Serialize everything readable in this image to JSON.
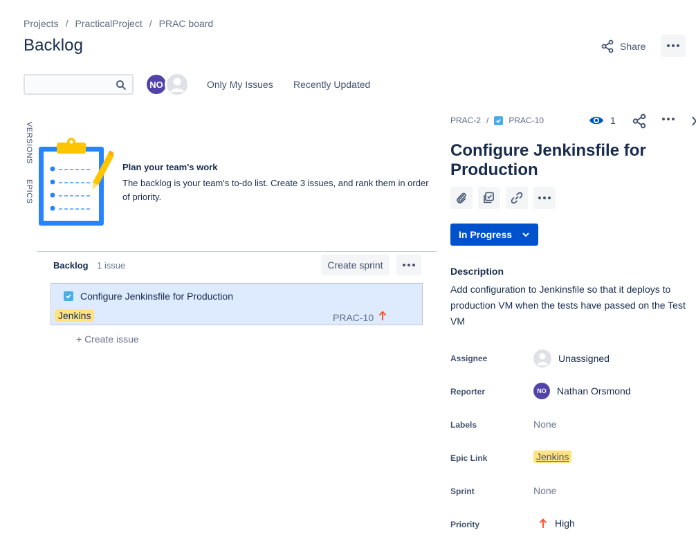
{
  "breadcrumb": {
    "items": [
      "Projects",
      "PracticalProject",
      "PRAC board"
    ],
    "separator": "/"
  },
  "page": {
    "title": "Backlog"
  },
  "header_actions": {
    "share_label": "Share"
  },
  "filters": {
    "search_value": "",
    "avatar_initials": "NO",
    "only_my_issues": "Only My Issues",
    "recently_updated": "Recently Updated"
  },
  "side_tabs": {
    "versions": "VERSIONS",
    "epics": "EPICS"
  },
  "empty_state": {
    "title": "Plan your team's work",
    "text": "The backlog is your team's to-do list. Create 3 issues, and rank them in order of priority."
  },
  "backlog": {
    "title": "Backlog",
    "count": "1 issue",
    "create_sprint": "Create sprint",
    "create_issue": "+  Create issue",
    "issues": [
      {
        "summary": "Configure Jenkinsfile for Production",
        "label": "Jenkins",
        "key": "PRAC-10",
        "priority": "High"
      }
    ]
  },
  "detail": {
    "parent_key": "PRAC-2",
    "separator": "/",
    "issue_key": "PRAC-10",
    "watchers": "1",
    "title": "Configure Jenkinsfile for Production",
    "status": "In Progress",
    "description_heading": "Description",
    "description": "Add configuration to Jenkinsfile so that it deploys to production VM when the tests have passed on the Test VM",
    "fields": {
      "assignee_label": "Assignee",
      "assignee_value": "Unassigned",
      "reporter_label": "Reporter",
      "reporter_value": "Nathan Orsmond",
      "reporter_initials": "NO",
      "labels_label": "Labels",
      "labels_value": "None",
      "epic_label": "Epic Link",
      "epic_value": "Jenkins",
      "sprint_label": "Sprint",
      "sprint_value": "None",
      "priority_label": "Priority",
      "priority_value": "High"
    }
  },
  "colors": {
    "primary": "#0052cc",
    "avatar": "#5243aa",
    "label": "#ffe380",
    "selected_row": "#deebff",
    "priority_high": "#ff5630",
    "subtask": "#4bade8"
  }
}
